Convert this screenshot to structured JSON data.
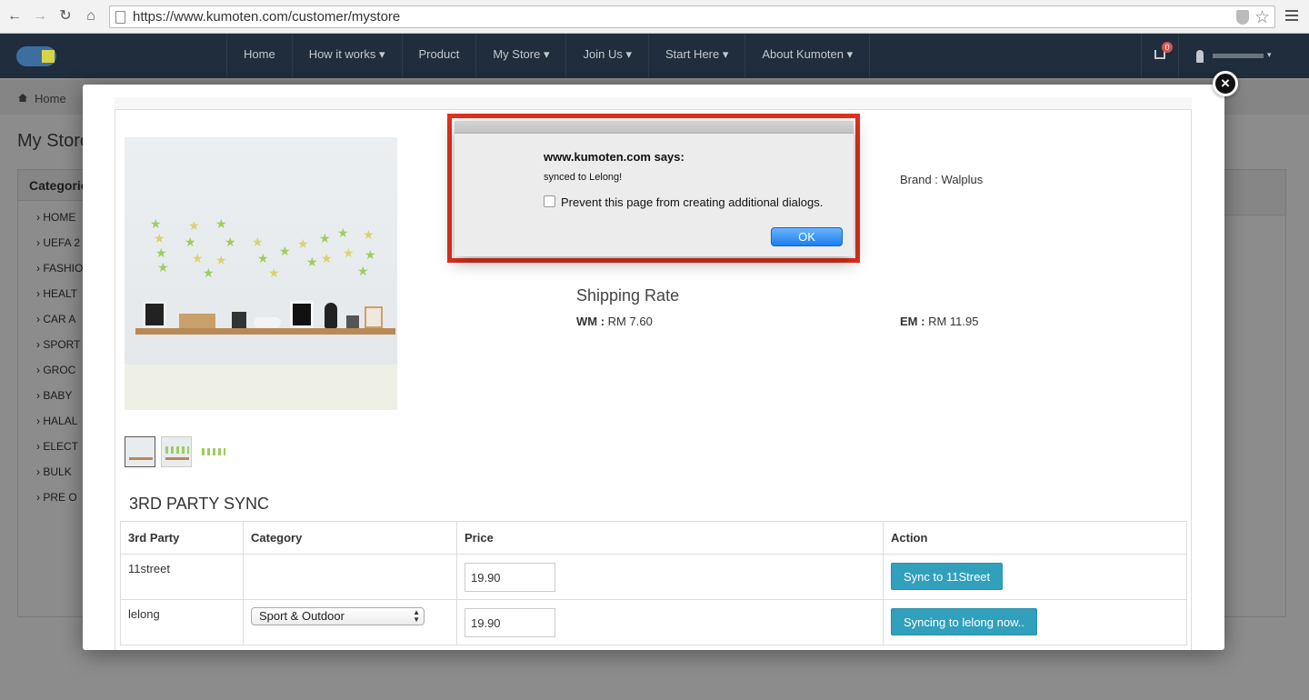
{
  "browser": {
    "url": "https://www.kumoten.com/customer/mystore"
  },
  "navbar": {
    "items": [
      {
        "label": "Home"
      },
      {
        "label": "How it works ▾"
      },
      {
        "label": "Product"
      },
      {
        "label": "My Store ▾"
      },
      {
        "label": "Join Us ▾"
      },
      {
        "label": "Start Here ▾"
      },
      {
        "label": "About Kumoten ▾"
      }
    ],
    "cart_count": "0"
  },
  "page": {
    "breadcrumb": "Home",
    "title": "My Store",
    "category_header": "Categories",
    "categories": [
      "HOME",
      "UEFA 2",
      "FASHIO",
      "HEALT",
      "CAR A",
      "SPORT",
      "GROC",
      "BABY",
      "HALAL",
      "ELECT",
      "BULK",
      "PRE O"
    ]
  },
  "modal": {
    "brand": "Brand : Walplus",
    "shipping_title": "Shipping Rate",
    "wm_label": "WM :",
    "wm_value": "RM 7.60",
    "em_label": "EM :",
    "em_value": "RM 11.95",
    "sync_title": "3RD PARTY SYNC",
    "table": {
      "headers": [
        "3rd Party",
        "Category",
        "Price",
        "Action"
      ],
      "rows": [
        {
          "party": "11street",
          "category": "",
          "price": "19.90",
          "action": "Sync to 11Street"
        },
        {
          "party": "lelong",
          "category": "Sport & Outdoor",
          "price": "19.90",
          "action": "Syncing to lelong now.."
        }
      ]
    }
  },
  "alert": {
    "title": "www.kumoten.com says:",
    "message": "synced to Lelong!",
    "checkbox_label": "Prevent this page from creating additional dialogs.",
    "ok_label": "OK"
  },
  "colors": {
    "navbar_bg": "#1f2d3d",
    "sync_button": "#31a0bd",
    "alert_highlight": "#e4321e",
    "ok_button": "#1a7ff0"
  }
}
